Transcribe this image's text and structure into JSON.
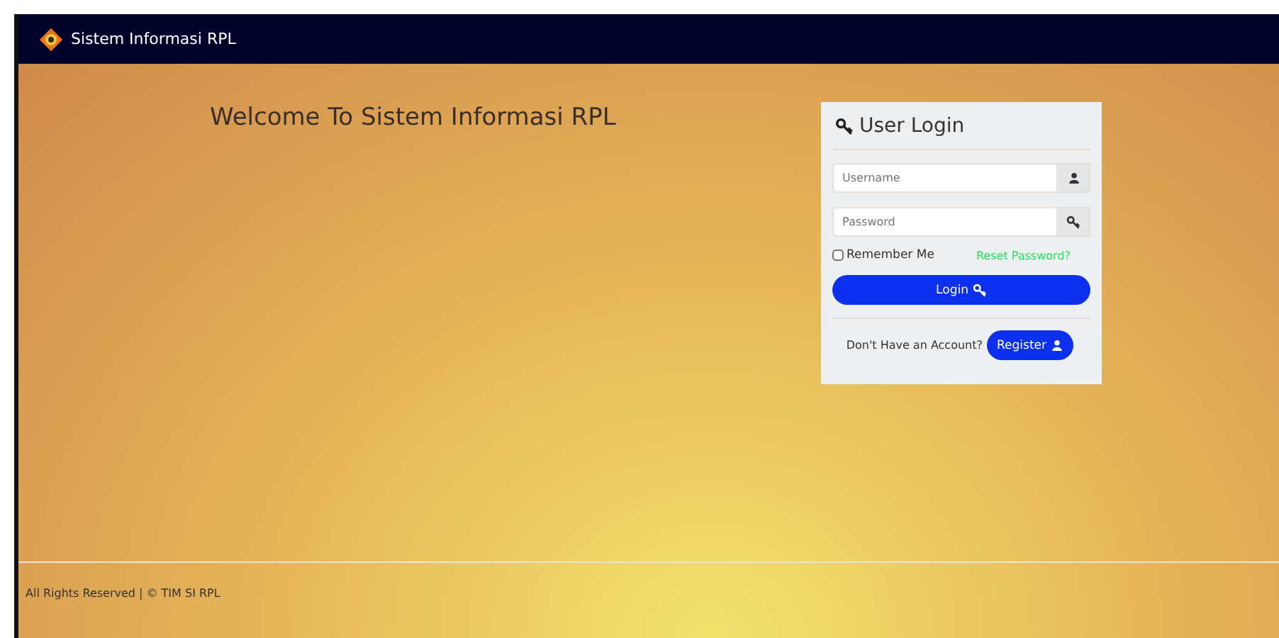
{
  "navbar": {
    "title": "Sistem Informasi RPL"
  },
  "welcome": "Welcome To Sistem Informasi RPL",
  "login": {
    "title": "User Login",
    "username": {
      "placeholder": "Username"
    },
    "password": {
      "placeholder": "Password"
    },
    "remember": {
      "label": "Remember Me",
      "checked": false
    },
    "reset_link": "Reset Password?",
    "login_button": "Login",
    "account_prompt": "Don't Have an Account?",
    "register_button": "Register"
  },
  "footer": "All Rights Reserved | © TIM SI RPL"
}
